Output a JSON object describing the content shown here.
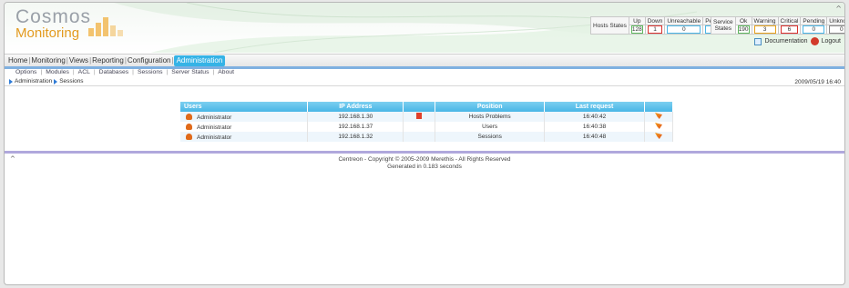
{
  "logo": {
    "line1": "Cosmos",
    "line2": "Monitoring"
  },
  "host_states": {
    "label": "Hosts States",
    "columns": [
      "Up",
      "Down",
      "Unreachable",
      "Pending"
    ],
    "values": [
      "128",
      "1",
      "0",
      "0"
    ],
    "colors": [
      "#5cb85c",
      "#d9302c",
      "#49b6e6",
      "#49b6e6"
    ]
  },
  "service_states": {
    "label": "Service States",
    "columns": [
      "Ok",
      "Warning",
      "Critical",
      "Pending",
      "Unknown"
    ],
    "values": [
      "190",
      "3",
      "6",
      "0",
      "0"
    ],
    "colors": [
      "#5cb85c",
      "#e6a11a",
      "#d9302c",
      "#49b6e6",
      "#8a8a8a"
    ]
  },
  "links": {
    "documentation": "Documentation",
    "logout": "Logout"
  },
  "menu": {
    "items": [
      "Home",
      "Monitoring",
      "Views",
      "Reporting",
      "Configuration",
      "Administration"
    ],
    "active": "Administration"
  },
  "submenu": [
    "Options",
    "Modules",
    "ACL",
    "Databases",
    "Sessions",
    "Server Status",
    "About"
  ],
  "breadcrumb": {
    "root": "Administration",
    "current": "Sessions"
  },
  "datetime": "2009/05/19 16:40",
  "sessions": {
    "headers": [
      "Users",
      "IP Address",
      "",
      "Position",
      "Last request",
      ""
    ],
    "rows": [
      {
        "user": "Administrator",
        "ip": "192.168.1.30",
        "position": "Hosts Problems",
        "last": "16:40:42",
        "has_pos_icon": true
      },
      {
        "user": "Administrator",
        "ip": "192.168.1.37",
        "position": "Users",
        "last": "16:40:38",
        "has_pos_icon": false
      },
      {
        "user": "Administrator",
        "ip": "192.168.1.32",
        "position": "Sessions",
        "last": "16:40:48",
        "has_pos_icon": false
      }
    ]
  },
  "footer": {
    "copyright": "Centreon - Copyright © 2005-2009 Merethis - All Rights Reserved",
    "generated": "Generated in 0.183 seconds"
  }
}
